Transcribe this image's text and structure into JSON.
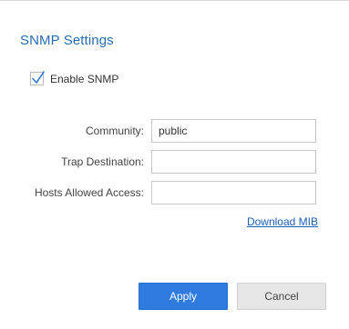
{
  "title": "SNMP Settings",
  "enable_snmp": {
    "label": "Enable SNMP",
    "checked": true
  },
  "fields": [
    {
      "label": "Community:",
      "value": "public",
      "placeholder": ""
    },
    {
      "label": "Trap Destination:",
      "value": "",
      "placeholder": ""
    },
    {
      "label": "Hosts Allowed Access:",
      "value": "",
      "placeholder": ""
    }
  ],
  "download_mib_link": "Download MIB",
  "buttons": {
    "apply": "Apply",
    "cancel": "Cancel"
  },
  "colors": {
    "accent": "#2f7be0",
    "title": "#2b6cb0",
    "link": "#1f5fb3",
    "check": "#3a7bd5"
  },
  "icons": {
    "checkmark": "checkmark-icon"
  }
}
